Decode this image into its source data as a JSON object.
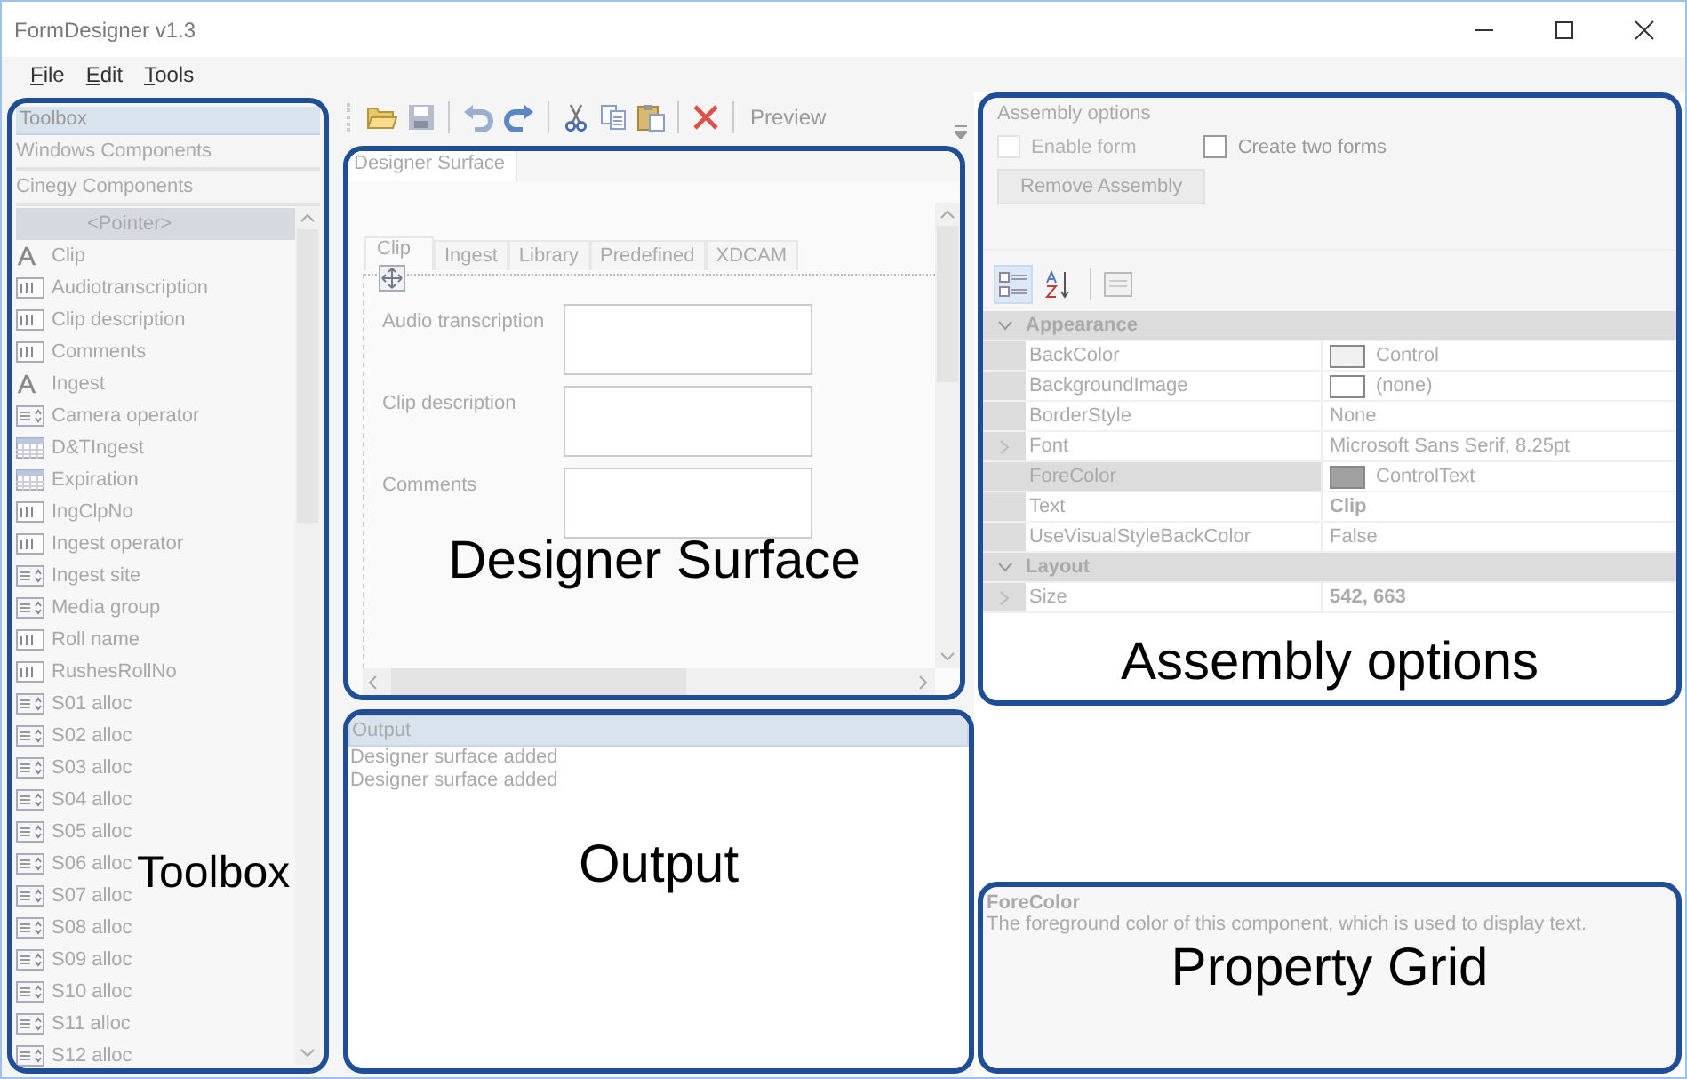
{
  "window": {
    "title": "FormDesigner v1.3"
  },
  "menu": [
    {
      "label": "File"
    },
    {
      "label": "Edit"
    },
    {
      "label": "Tools"
    }
  ],
  "toolbar": {
    "buttons": [
      {
        "kind": "open"
      },
      {
        "kind": "save"
      },
      {
        "kind": "undo"
      },
      {
        "kind": "redo"
      },
      {
        "kind": "cut"
      },
      {
        "kind": "copy"
      },
      {
        "kind": "paste"
      },
      {
        "kind": "delete"
      }
    ],
    "preview": "Preview"
  },
  "toolbox": {
    "title": "Toolbox",
    "groups": [
      {
        "label": "Windows Components"
      },
      {
        "label": "Cinegy Components"
      }
    ],
    "items": [
      {
        "label": "<Pointer>",
        "kind": "pointer",
        "selected": true
      },
      {
        "label": "Clip",
        "kind": "label",
        "selected": false
      },
      {
        "label": "Audiotranscription",
        "kind": "textbox",
        "selected": false
      },
      {
        "label": "Clip description",
        "kind": "textbox",
        "selected": false
      },
      {
        "label": "Comments",
        "kind": "textbox",
        "selected": false
      },
      {
        "label": "Ingest",
        "kind": "label",
        "selected": false
      },
      {
        "label": "Camera operator",
        "kind": "numeric",
        "selected": false
      },
      {
        "label": "D&TIngest",
        "kind": "calendar",
        "selected": false
      },
      {
        "label": "Expiration",
        "kind": "calendar",
        "selected": false
      },
      {
        "label": "IngClpNo",
        "kind": "textbox",
        "selected": false
      },
      {
        "label": "Ingest operator",
        "kind": "textbox",
        "selected": false
      },
      {
        "label": "Ingest site",
        "kind": "numeric",
        "selected": false
      },
      {
        "label": "Media group",
        "kind": "numeric",
        "selected": false
      },
      {
        "label": "Roll name",
        "kind": "textbox",
        "selected": false
      },
      {
        "label": "RushesRollNo",
        "kind": "textbox",
        "selected": false
      },
      {
        "label": "S01 alloc",
        "kind": "numeric",
        "selected": false
      },
      {
        "label": "S02 alloc",
        "kind": "numeric",
        "selected": false
      },
      {
        "label": "S03 alloc",
        "kind": "numeric",
        "selected": false
      },
      {
        "label": "S04 alloc",
        "kind": "numeric",
        "selected": false
      },
      {
        "label": "S05 alloc",
        "kind": "numeric",
        "selected": false
      },
      {
        "label": "S06 alloc",
        "kind": "numeric",
        "selected": false
      },
      {
        "label": "S07 alloc",
        "kind": "numeric",
        "selected": false
      },
      {
        "label": "S08 alloc",
        "kind": "numeric",
        "selected": false
      },
      {
        "label": "S09 alloc",
        "kind": "numeric",
        "selected": false
      },
      {
        "label": "S10 alloc",
        "kind": "numeric",
        "selected": false
      },
      {
        "label": "S11 alloc",
        "kind": "numeric",
        "selected": false
      },
      {
        "label": "S12 alloc",
        "kind": "numeric",
        "selected": false
      }
    ]
  },
  "designer": {
    "tab": "Designer Surface",
    "form_tabs": [
      {
        "label": "Clip",
        "selected": true
      },
      {
        "label": "Ingest",
        "selected": false
      },
      {
        "label": "Library",
        "selected": false
      },
      {
        "label": "Predefined",
        "selected": false
      },
      {
        "label": "XDCAM",
        "selected": false
      }
    ],
    "fields": [
      {
        "label": "Audio transcription"
      },
      {
        "label": "Clip description"
      },
      {
        "label": "Comments"
      }
    ]
  },
  "output": {
    "title": "Output",
    "lines": [
      "Designer surface added",
      "Designer surface added"
    ]
  },
  "assembly": {
    "title": "Assembly options",
    "options": [
      {
        "label": "Enable form",
        "checked": false,
        "disabled": true
      },
      {
        "label": "Create two forms",
        "checked": false,
        "disabled": false
      }
    ],
    "remove_button": {
      "label": "Remove Assembly",
      "disabled": true
    }
  },
  "property_grid": {
    "sort": [
      {
        "kind": "categorized",
        "selected": true
      },
      {
        "kind": "alphabetical",
        "selected": false
      }
    ],
    "categories": [
      {
        "name": "Appearance",
        "expanded": true,
        "properties": [
          {
            "name": "BackColor",
            "value": "Control",
            "color": "#f0f0f0",
            "modified": false,
            "expandable": false,
            "selected": false
          },
          {
            "name": "BackgroundImage",
            "value": "(none)",
            "color": "#ffffff",
            "modified": false,
            "expandable": false,
            "selected": false
          },
          {
            "name": "BorderStyle",
            "value": "None",
            "modified": false,
            "expandable": false,
            "selected": false
          },
          {
            "name": "Font",
            "value": "Microsoft Sans Serif, 8.25pt",
            "modified": false,
            "expandable": true,
            "selected": false
          },
          {
            "name": "ForeColor",
            "value": "ControlText",
            "color": "#a0a0a0",
            "modified": false,
            "expandable": false,
            "selected": true
          },
          {
            "name": "Text",
            "value": "Clip",
            "modified": true,
            "expandable": false,
            "selected": false
          },
          {
            "name": "UseVisualStyleBackColor",
            "value": "False",
            "modified": false,
            "expandable": false,
            "selected": false
          }
        ]
      },
      {
        "name": "Layout",
        "expanded": true,
        "properties": [
          {
            "name": "Size",
            "value": "542, 663",
            "modified": true,
            "expandable": true,
            "selected": false
          }
        ]
      }
    ],
    "description": {
      "title": "ForeColor",
      "text": "The foreground color of this component, which is used to display text."
    }
  },
  "annotations": [
    {
      "label": "Toolbox"
    },
    {
      "label": "Designer Surface"
    },
    {
      "label": "Assembly options"
    },
    {
      "label": "Output"
    },
    {
      "label": "Property Grid"
    }
  ]
}
